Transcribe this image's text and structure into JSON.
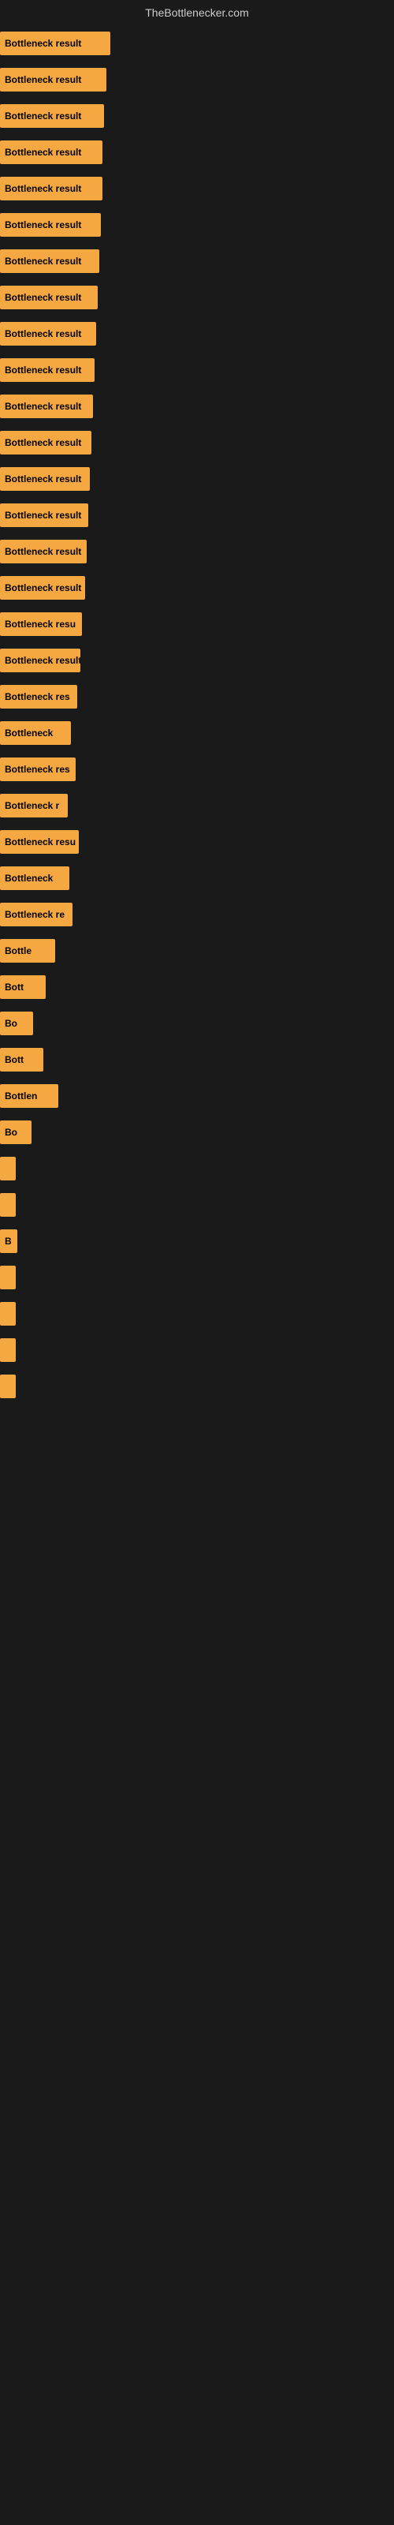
{
  "header": {
    "title": "TheBottlenecker.com"
  },
  "bars": [
    {
      "label": "Bottleneck result",
      "width": 140
    },
    {
      "label": "Bottleneck result",
      "width": 135
    },
    {
      "label": "Bottleneck result",
      "width": 132
    },
    {
      "label": "Bottleneck result",
      "width": 130
    },
    {
      "label": "Bottleneck result",
      "width": 130
    },
    {
      "label": "Bottleneck result",
      "width": 128
    },
    {
      "label": "Bottleneck result",
      "width": 126
    },
    {
      "label": "Bottleneck result",
      "width": 124
    },
    {
      "label": "Bottleneck result",
      "width": 122
    },
    {
      "label": "Bottleneck result",
      "width": 120
    },
    {
      "label": "Bottleneck result",
      "width": 118
    },
    {
      "label": "Bottleneck result",
      "width": 116
    },
    {
      "label": "Bottleneck result",
      "width": 114
    },
    {
      "label": "Bottleneck result",
      "width": 112
    },
    {
      "label": "Bottleneck result",
      "width": 110
    },
    {
      "label": "Bottleneck result",
      "width": 108
    },
    {
      "label": "Bottleneck resu",
      "width": 104
    },
    {
      "label": "Bottleneck result",
      "width": 102
    },
    {
      "label": "Bottleneck res",
      "width": 98
    },
    {
      "label": "Bottleneck",
      "width": 90
    },
    {
      "label": "Bottleneck res",
      "width": 96
    },
    {
      "label": "Bottleneck r",
      "width": 86
    },
    {
      "label": "Bottleneck resu",
      "width": 100
    },
    {
      "label": "Bottleneck",
      "width": 88
    },
    {
      "label": "Bottleneck re",
      "width": 92
    },
    {
      "label": "Bottle",
      "width": 70
    },
    {
      "label": "Bott",
      "width": 58
    },
    {
      "label": "Bo",
      "width": 42
    },
    {
      "label": "Bott",
      "width": 55
    },
    {
      "label": "Bottlen",
      "width": 74
    },
    {
      "label": "Bo",
      "width": 40
    },
    {
      "label": "",
      "width": 20
    },
    {
      "label": "",
      "width": 14
    },
    {
      "label": "B",
      "width": 22
    },
    {
      "label": "",
      "width": 8
    },
    {
      "label": "",
      "width": 6
    },
    {
      "label": "",
      "width": 4
    },
    {
      "label": "",
      "width": 3
    }
  ]
}
